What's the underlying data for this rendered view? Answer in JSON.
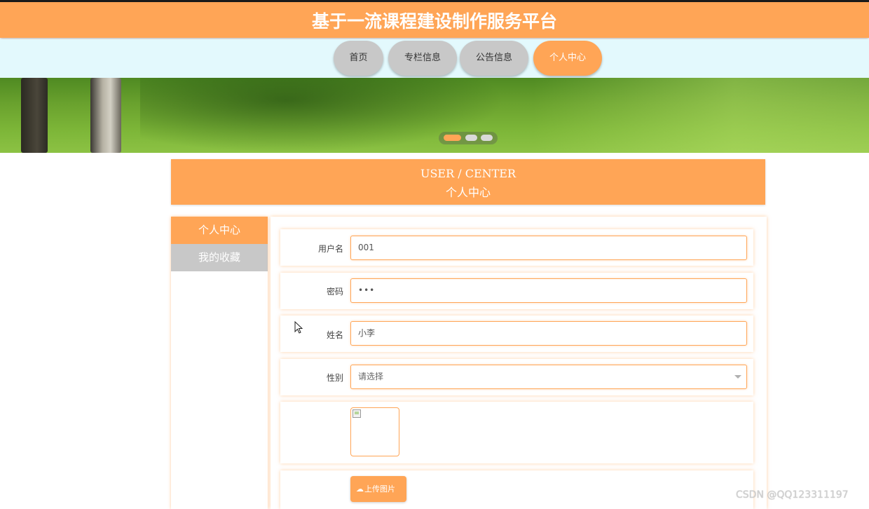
{
  "header": {
    "title": "基于一流课程建设制作服务平台"
  },
  "nav": {
    "items": [
      "首页",
      "专栏信息",
      "公告信息",
      "个人中心"
    ],
    "active_index": 3
  },
  "banner": {
    "dot_count": 3,
    "active_dot": 0
  },
  "center": {
    "title_en": "USER / CENTER",
    "title_cn": "个人中心"
  },
  "sidebar": {
    "items": [
      "个人中心",
      "我的收藏"
    ],
    "active_index": 0
  },
  "form": {
    "username_label": "用户名",
    "username_value": "001",
    "password_label": "密码",
    "password_value": "•••",
    "name_label": "姓名",
    "name_value": "小李",
    "gender_label": "性别",
    "gender_placeholder": "请选择",
    "upload_label": "上传图片"
  },
  "icons": {
    "upload": "cloud-upload-icon",
    "select_caret": "chevron-down-icon",
    "broken_image": "broken-image-icon",
    "cursor": "mouse-cursor-icon"
  },
  "colors": {
    "accent": "#ffa556",
    "nav_bg": "#e3f9fd",
    "inactive": "#c8c8c8"
  },
  "watermark": "CSDN @QQ123311197"
}
